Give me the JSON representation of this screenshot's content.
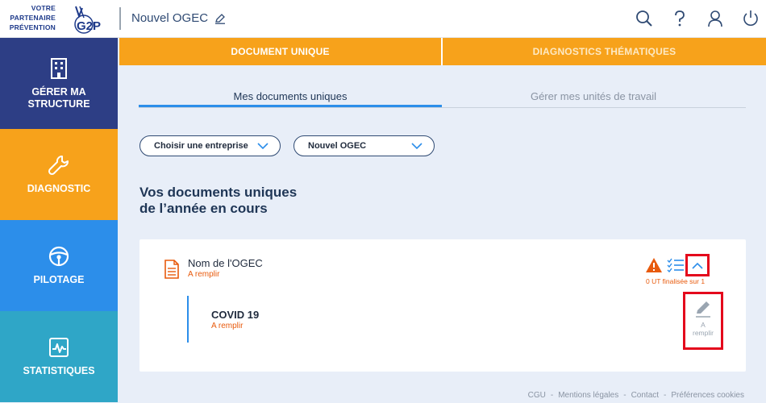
{
  "logo": {
    "line1": "VOTRE",
    "line2": "PARTENAIRE",
    "line3": "PRÉVENTION",
    "mark": "G2P"
  },
  "header": {
    "title": "Nouvel OGEC"
  },
  "sidebar": {
    "items": [
      {
        "label": "GÉRER MA STRUCTURE",
        "icon": "building-icon"
      },
      {
        "label": "DIAGNOSTIC",
        "icon": "wrench-icon"
      },
      {
        "label": "PILOTAGE",
        "icon": "steering-wheel-icon"
      },
      {
        "label": "STATISTIQUES",
        "icon": "pulse-chart-icon"
      }
    ]
  },
  "top_tabs": {
    "tab1": "DOCUMENT UNIQUE",
    "tab2": "DIAGNOSTICS THÉMATIQUES"
  },
  "sub_tabs": {
    "tab1": "Mes documents uniques",
    "tab2": "Gérer mes unités de travail"
  },
  "selects": {
    "company": "Choisir une entreprise",
    "structure": "Nouvel OGEC"
  },
  "section": {
    "title_line1": "Vos documents uniques",
    "title_line2": "de l’année en cours"
  },
  "document": {
    "name": "Nom de l'OGEC",
    "status": "A remplir",
    "ut_count": "0 UT finalisée sur 1"
  },
  "unit": {
    "name": "COVID 19",
    "status": "A remplir",
    "edit_label_1": "A",
    "edit_label_2": "remplir"
  },
  "footer": {
    "cgu": "CGU",
    "legal": "Mentions légales",
    "contact": "Contact",
    "cookies": "Préférences cookies",
    "separator": "-"
  },
  "colors": {
    "navy": "#2d3e85",
    "orange": "#f7a21b",
    "blue": "#2c8eea",
    "teal": "#2fa6c7",
    "alert": "#e85a0c",
    "highlight_red": "#e4081c"
  }
}
